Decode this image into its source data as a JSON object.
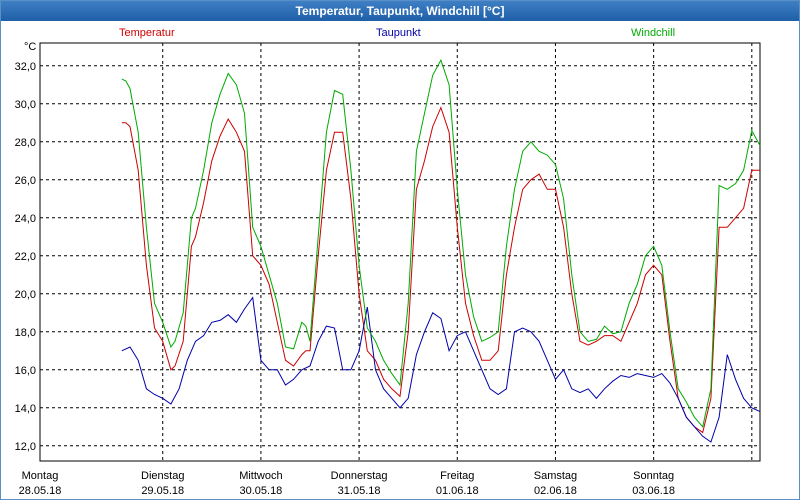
{
  "window": {
    "title": "Temperatur, Taupunkt, Windchill [°C]"
  },
  "chart_data": {
    "type": "line",
    "title": "Temperatur, Taupunkt, Windchill [°C]",
    "unit_label": "°C",
    "ylim": [
      11.2,
      33.2
    ],
    "xlim_hours": [
      0,
      176
    ],
    "grid": true,
    "legend_placement": "top",
    "y_ticks": [
      "12,0",
      "14,0",
      "16,0",
      "18,0",
      "20,0",
      "22,0",
      "24,0",
      "26,0",
      "28,0",
      "30,0",
      "32,0"
    ],
    "y_tick_values": [
      12,
      14,
      16,
      18,
      20,
      22,
      24,
      26,
      28,
      30,
      32
    ],
    "days": [
      {
        "name": "Montag",
        "date": "28.05.18"
      },
      {
        "name": "Dienstag",
        "date": "29.05.18"
      },
      {
        "name": "Mittwoch",
        "date": "30.05.18"
      },
      {
        "name": "Donnerstag",
        "date": "31.05.18"
      },
      {
        "name": "Freitag",
        "date": "01.06.18"
      },
      {
        "name": "Samstag",
        "date": "02.06.18"
      },
      {
        "name": "Sonntag",
        "date": "03.06.18"
      }
    ],
    "series": [
      {
        "name": "Temperatur",
        "color": "#cc0000",
        "x": [
          20,
          21,
          22,
          24,
          26,
          28,
          30,
          32,
          33,
          35,
          37,
          38,
          40,
          42,
          44,
          46,
          48,
          50,
          52,
          54,
          56,
          58,
          60,
          62,
          64,
          65,
          66,
          68,
          70,
          72,
          74,
          76,
          78,
          80,
          82,
          84,
          86,
          88,
          90,
          92,
          94,
          96,
          98,
          100,
          102,
          104,
          106,
          108,
          110,
          112,
          114,
          116,
          118,
          120,
          122,
          124,
          126,
          128,
          130,
          132,
          134,
          136,
          138,
          140,
          142,
          144,
          146,
          148,
          150,
          152,
          154,
          156,
          158,
          160,
          162,
          164,
          166,
          168,
          170,
          172,
          174,
          176
        ],
        "y": [
          29.0,
          29.0,
          28.8,
          26.5,
          21.5,
          18.2,
          17.5,
          16.0,
          16.2,
          17.5,
          22.5,
          23.0,
          24.8,
          27.0,
          28.3,
          29.2,
          28.5,
          27.5,
          22.0,
          21.5,
          20.5,
          18.5,
          16.5,
          16.2,
          16.8,
          17.0,
          17.0,
          22.0,
          26.5,
          28.5,
          28.5,
          25.0,
          20.0,
          17.0,
          16.5,
          15.5,
          15.0,
          14.6,
          18.0,
          25.5,
          27.0,
          28.8,
          29.8,
          28.5,
          23.5,
          19.5,
          17.8,
          16.5,
          16.5,
          17.0,
          21.0,
          23.5,
          25.5,
          26.0,
          26.3,
          25.5,
          25.5,
          23.5,
          20.0,
          17.5,
          17.3,
          17.5,
          17.8,
          17.8,
          17.5,
          18.5,
          19.5,
          21.0,
          21.5,
          21.0,
          17.5,
          14.5,
          13.5,
          13.0,
          12.7,
          14.5,
          23.5,
          23.5,
          24.0,
          24.5,
          26.5,
          26.5
        ]
      },
      {
        "name": "Taupunkt",
        "color": "#0000aa",
        "x": [
          20,
          22,
          24,
          26,
          28,
          30,
          32,
          34,
          36,
          38,
          40,
          42,
          44,
          46,
          48,
          50,
          52,
          54,
          56,
          58,
          60,
          62,
          64,
          66,
          68,
          70,
          72,
          74,
          76,
          78,
          80,
          82,
          84,
          86,
          88,
          90,
          92,
          94,
          96,
          98,
          100,
          102,
          104,
          106,
          108,
          110,
          112,
          114,
          116,
          118,
          120,
          122,
          124,
          126,
          128,
          130,
          132,
          134,
          136,
          138,
          140,
          142,
          144,
          146,
          148,
          150,
          152,
          154,
          156,
          158,
          160,
          162,
          164,
          166,
          168,
          170,
          172,
          174,
          176
        ],
        "y": [
          17.0,
          17.2,
          16.5,
          15.0,
          14.7,
          14.5,
          14.2,
          15.0,
          16.5,
          17.5,
          17.8,
          18.5,
          18.6,
          18.9,
          18.5,
          19.2,
          19.8,
          16.5,
          16.0,
          16.0,
          15.2,
          15.5,
          16.0,
          16.2,
          17.5,
          18.3,
          18.2,
          16.0,
          16.0,
          17.0,
          19.3,
          16.0,
          15.0,
          14.5,
          14.0,
          14.5,
          16.8,
          18.0,
          19.0,
          18.7,
          17.0,
          17.8,
          18.0,
          17.0,
          16.0,
          15.0,
          14.7,
          15.0,
          18.0,
          18.2,
          18.0,
          17.5,
          16.5,
          15.5,
          16.0,
          15.0,
          14.8,
          15.0,
          14.5,
          15.0,
          15.4,
          15.7,
          15.6,
          15.8,
          15.7,
          15.6,
          15.8,
          15.3,
          14.5,
          13.5,
          13.0,
          12.5,
          12.2,
          13.5,
          16.8,
          15.5,
          14.5,
          14.0,
          13.8
        ]
      },
      {
        "name": "Windchill",
        "color": "#00aa00",
        "x": [
          20,
          21,
          22,
          24,
          26,
          28,
          30,
          32,
          33,
          35,
          37,
          38,
          40,
          42,
          44,
          46,
          48,
          50,
          52,
          54,
          56,
          58,
          60,
          62,
          64,
          65,
          66,
          68,
          70,
          72,
          74,
          76,
          78,
          80,
          82,
          84,
          86,
          88,
          90,
          92,
          94,
          96,
          98,
          100,
          102,
          104,
          106,
          108,
          110,
          112,
          114,
          116,
          118,
          120,
          122,
          124,
          126,
          128,
          130,
          132,
          134,
          136,
          138,
          140,
          142,
          144,
          146,
          148,
          150,
          152,
          154,
          156,
          158,
          160,
          162,
          164,
          166,
          168,
          170,
          172,
          174,
          176
        ],
        "y": [
          31.3,
          31.2,
          30.8,
          28.5,
          23.5,
          19.5,
          18.5,
          17.2,
          17.5,
          19.0,
          24.0,
          24.5,
          26.5,
          29.0,
          30.5,
          31.6,
          31.0,
          29.5,
          23.5,
          22.5,
          21.0,
          19.5,
          17.2,
          17.1,
          18.5,
          18.3,
          17.5,
          23.0,
          28.5,
          30.7,
          30.5,
          26.5,
          21.5,
          18.2,
          17.5,
          16.5,
          15.8,
          15.2,
          19.5,
          27.5,
          29.5,
          31.5,
          32.3,
          31.0,
          25.5,
          21.0,
          18.8,
          17.5,
          17.7,
          18.0,
          22.5,
          25.5,
          27.5,
          28.0,
          27.5,
          27.3,
          26.8,
          25.0,
          21.0,
          18.0,
          17.5,
          17.6,
          18.3,
          17.9,
          18.0,
          19.5,
          20.5,
          22.0,
          22.5,
          21.5,
          18.0,
          15.0,
          14.3,
          13.5,
          13.0,
          15.0,
          25.7,
          25.5,
          25.8,
          26.5,
          28.6,
          27.8
        ]
      }
    ]
  }
}
